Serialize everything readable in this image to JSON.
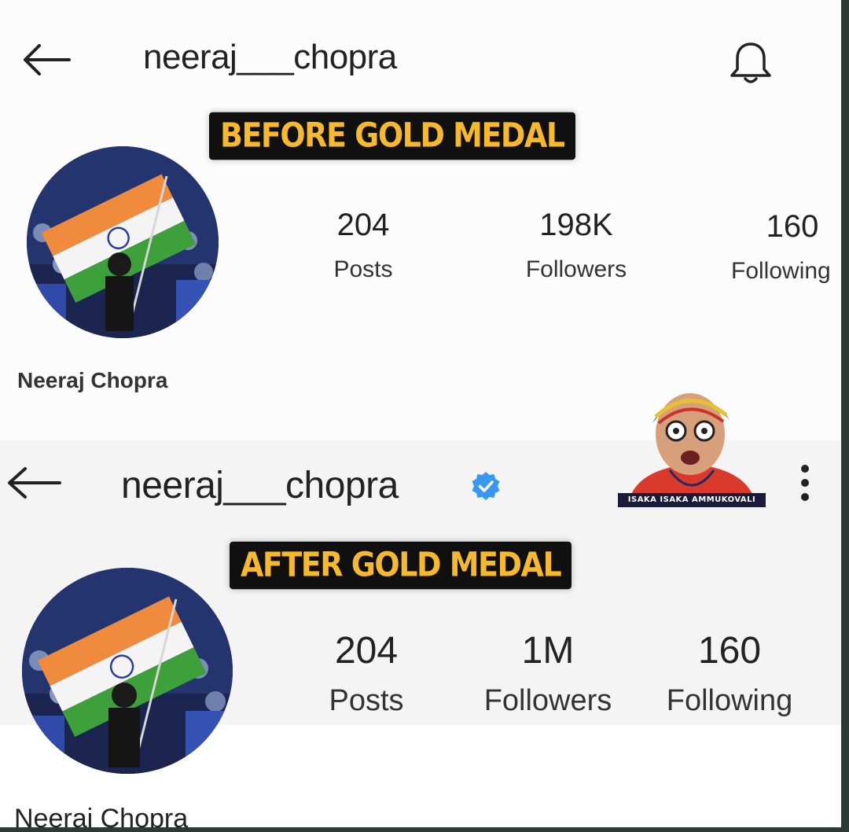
{
  "before": {
    "username": "neeraj___chopra",
    "caption": "BEFORE GOLD MEDAL",
    "stats": [
      {
        "value": "204",
        "label": "Posts"
      },
      {
        "value": "198K",
        "label": "Followers"
      },
      {
        "value": "160",
        "label": "Following"
      }
    ],
    "display_name": "Neeraj Chopra",
    "icons": {
      "back": "back-arrow-icon",
      "notify": "bell-icon"
    }
  },
  "after": {
    "username": "neeraj___chopra",
    "caption": "AFTER GOLD MEDAL",
    "stats": [
      {
        "value": "204",
        "label": "Posts"
      },
      {
        "value": "1M",
        "label": "Followers"
      },
      {
        "value": "160",
        "label": "Following"
      }
    ],
    "display_name": "Neeraj Chopra",
    "icons": {
      "back": "back-arrow-icon",
      "verified": "verified-badge-icon",
      "more": "more-options-icon"
    }
  },
  "sticker": {
    "text": "ISAKA ISAKA AMMUKOVALI"
  },
  "colors": {
    "caption_text": "#f6b92b",
    "caption_bg": "#101010",
    "verified": "#3897f0"
  }
}
